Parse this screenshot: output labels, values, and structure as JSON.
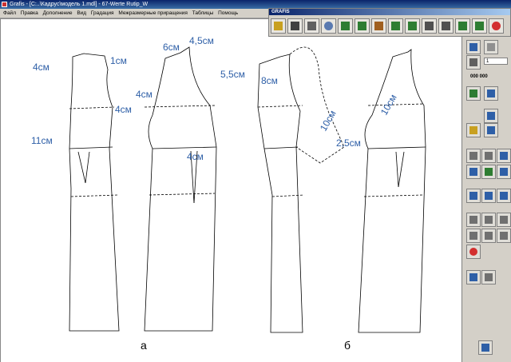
{
  "window": {
    "title": "Grafis - [C:..\\Кадрус\\модель 1.mdl] - 67-Werte Rutip_W"
  },
  "menu": {
    "items": [
      "Файл",
      "Правка",
      "Дополнение",
      "Вид",
      "Градация",
      "Межразмерные приращения",
      "Таблицы",
      "Помощь"
    ]
  },
  "toolbar_panel": {
    "title": "GRAFIS",
    "buttons": [
      {
        "name": "open-folder-icon",
        "color": "#c8a020"
      },
      {
        "name": "save-icon",
        "color": "#404040"
      },
      {
        "name": "print-icon",
        "color": "#606060"
      },
      {
        "name": "zoom-icon",
        "color": "#5a7ab0"
      },
      {
        "name": "f6-tool-icon",
        "color": "#2e7d32"
      },
      {
        "name": "layers-icon",
        "color": "#2e7d32"
      },
      {
        "name": "measure-icon",
        "color": "#a06020"
      },
      {
        "name": "download-icon",
        "color": "#2e7d32"
      },
      {
        "name": "import-icon",
        "color": "#2e7d32"
      },
      {
        "name": "g-icon",
        "color": "#505050"
      },
      {
        "name": "x-icon",
        "color": "#505050"
      },
      {
        "name": "f11-icon",
        "color": "#2e7d32"
      },
      {
        "name": "f12-icon",
        "color": "#2e7d32"
      },
      {
        "name": "stop-icon",
        "color": "#d32f2f"
      }
    ]
  },
  "side_panel": {
    "counter": "000 000",
    "field_value": "1"
  },
  "canvas": {
    "measurements_a": [
      "4см",
      "1см",
      "4см",
      "11см"
    ],
    "measurements_a2": [
      "6см",
      "4,5см",
      "5,5см",
      "4см",
      "4см"
    ],
    "measurements_b": [
      "8см",
      "10см",
      "2,5см"
    ],
    "measurements_b2": [
      "10см"
    ],
    "figure_labels": [
      "а",
      "б"
    ]
  },
  "colors": {
    "annotation": "#2e5fa7",
    "titlebar": "#0a246a",
    "chrome": "#d4d0c8"
  }
}
